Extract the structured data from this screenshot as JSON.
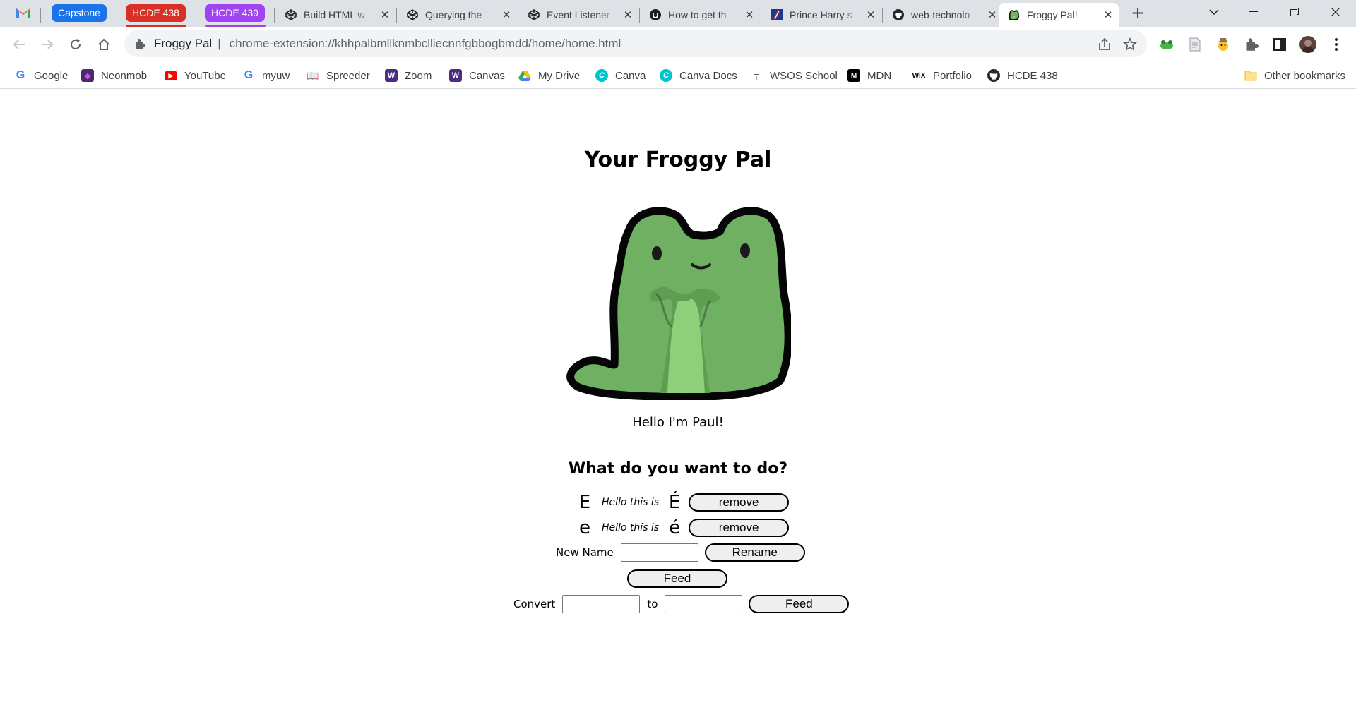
{
  "browser": {
    "groups": [
      {
        "label": "Capstone",
        "color": "#1a73e8"
      },
      {
        "label": "HCDE 438",
        "color": "#d93025"
      },
      {
        "label": "HCDE 439",
        "color": "#a142f4"
      }
    ],
    "tabs": [
      {
        "title": "Build HTML w",
        "icon": "codepen-icon"
      },
      {
        "title": "Querying the",
        "icon": "codepen-icon"
      },
      {
        "title": "Event Listener",
        "icon": "codepen-icon"
      },
      {
        "title": "How to get th",
        "icon": "udemy-icon"
      },
      {
        "title": "Prince Harry s",
        "icon": "news-icon"
      },
      {
        "title": "web-technolo",
        "icon": "github-icon"
      },
      {
        "title": "Froggy Pal!",
        "icon": "frog-icon",
        "active": true
      }
    ],
    "omnibox": {
      "site_name": "Froggy Pal",
      "separator": "|",
      "url": "chrome-extension://khhpalbmllknmbclliecnnfgbbogbmdd/home/home.html"
    },
    "bookmarks": [
      {
        "label": "Google",
        "icon": "google-icon"
      },
      {
        "label": "Neonmob",
        "icon": "neonmob-icon"
      },
      {
        "label": "YouTube",
        "icon": "youtube-icon"
      },
      {
        "label": "myuw",
        "icon": "google-icon"
      },
      {
        "label": "Spreeder",
        "icon": "book-icon"
      },
      {
        "label": "Zoom",
        "icon": "w-icon"
      },
      {
        "label": "Canvas",
        "icon": "w-icon"
      },
      {
        "label": "My Drive",
        "icon": "drive-icon"
      },
      {
        "label": "Canva",
        "icon": "canva-icon"
      },
      {
        "label": "Canva Docs",
        "icon": "canva-icon"
      },
      {
        "label": "WSOS School",
        "icon": "wsos-icon"
      },
      {
        "label": "MDN",
        "icon": "mdn-icon"
      },
      {
        "label": "Portfolio",
        "icon": "wix-icon"
      },
      {
        "label": "HCDE 438",
        "icon": "github-icon"
      }
    ],
    "other_bookmarks": "Other bookmarks"
  },
  "page": {
    "title": "Your Froggy Pal",
    "greeting": "Hello I'm Paul!",
    "question": "What do you want to do?",
    "rows": [
      {
        "char_before": "E",
        "text": "Hello this is",
        "char_after": "É",
        "button": "remove"
      },
      {
        "char_before": "e",
        "text": "Hello this is",
        "char_after": "é",
        "button": "remove"
      }
    ],
    "rename": {
      "label": "New Name",
      "value": "",
      "button": "Rename"
    },
    "feed_button": "Feed",
    "convert": {
      "label": "Convert",
      "from_value": "",
      "to_label": "to",
      "to_value": "",
      "button": "Feed"
    }
  }
}
